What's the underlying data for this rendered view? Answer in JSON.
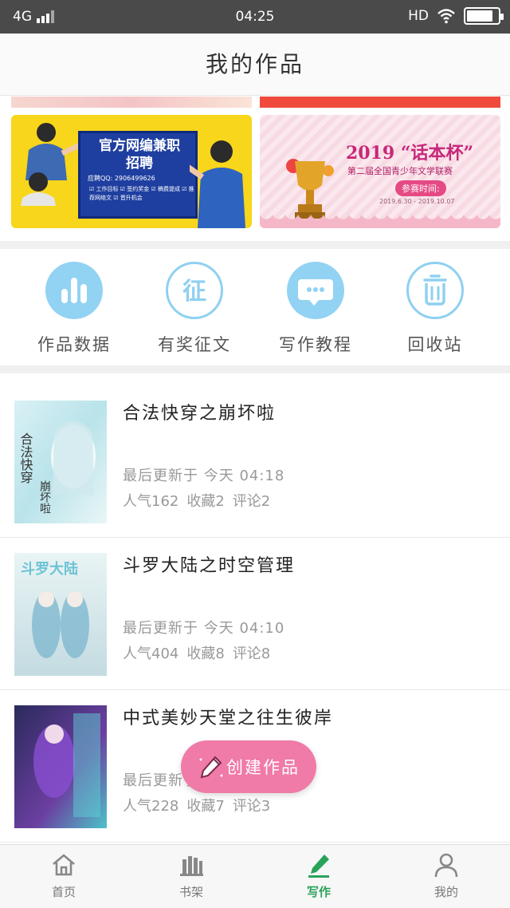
{
  "status_bar": {
    "network": "4G",
    "time": "04:25",
    "hd": "HD",
    "battery_level": 0.85
  },
  "header": {
    "title": "我的作品"
  },
  "banners": {
    "job": {
      "title_line1": "官方网编兼职",
      "title_line2": "招聘",
      "qq": "应聘QQ: 2906499626",
      "perks": "☑ 工作目标  ☑ 签约奖金  ☑ 稿费提成  ☑ 推荐网络文  ☑ 晋升机会"
    },
    "contest": {
      "title": "2019 “话本杯”",
      "subtitle": "第二届全国青少年文学联赛",
      "pill": "参赛时间:",
      "date": "2019.6.30 - 2019.10.07"
    }
  },
  "actions": [
    {
      "label": "作品数据",
      "icon": "bar-chart-icon"
    },
    {
      "label": "有奖征文",
      "icon": "contest-icon"
    },
    {
      "label": "写作教程",
      "icon": "chat-bubble-icon"
    },
    {
      "label": "回收站",
      "icon": "trash-icon"
    }
  ],
  "works": [
    {
      "title": "合法快穿之崩坏啦",
      "updated": "最后更新于 今天 04:18",
      "popularity": "人气162",
      "favorites": "收藏2",
      "comments": "评论2",
      "cover_text": "合法快穿之崩坏啦"
    },
    {
      "title": "斗罗大陆之时空管理",
      "updated": "最后更新于 今天 04:10",
      "popularity": "人气404",
      "favorites": "收藏8",
      "comments": "评论8",
      "cover_text": "斗罗大陆"
    },
    {
      "title": "中式美妙天堂之往生彼岸",
      "updated": "最后更新于 今天 04:0",
      "popularity": "人气228",
      "favorites": "收藏7",
      "comments": "评论3",
      "cover_text": ""
    }
  ],
  "fab": {
    "label": "创建作品"
  },
  "bottom_nav": [
    {
      "label": "首页",
      "icon": "home-icon",
      "active": false
    },
    {
      "label": "书架",
      "icon": "bookshelf-icon",
      "active": false
    },
    {
      "label": "写作",
      "icon": "write-icon",
      "active": true
    },
    {
      "label": "我的",
      "icon": "profile-icon",
      "active": false
    }
  ],
  "colors": {
    "accent_blue": "#92d2f3",
    "fab_pink": "#f07aa8",
    "nav_active_green": "#2aa35a",
    "job_banner_yellow": "#f7d61b"
  }
}
